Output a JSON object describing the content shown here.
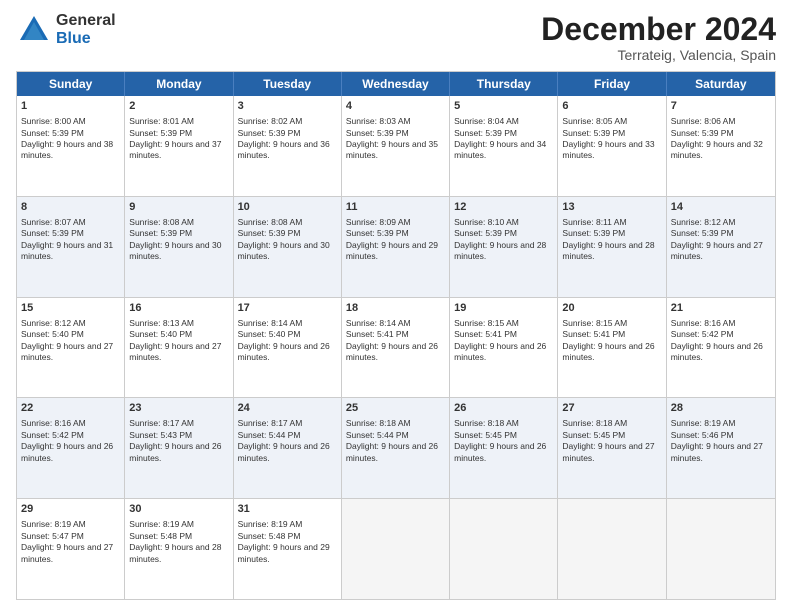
{
  "header": {
    "logo": {
      "general": "General",
      "blue": "Blue"
    },
    "title": "December 2024",
    "location": "Terrateig, Valencia, Spain"
  },
  "calendar": {
    "days": [
      "Sunday",
      "Monday",
      "Tuesday",
      "Wednesday",
      "Thursday",
      "Friday",
      "Saturday"
    ],
    "rows": [
      [
        {
          "day": "1",
          "sunrise": "Sunrise: 8:00 AM",
          "sunset": "Sunset: 5:39 PM",
          "daylight": "Daylight: 9 hours and 38 minutes."
        },
        {
          "day": "2",
          "sunrise": "Sunrise: 8:01 AM",
          "sunset": "Sunset: 5:39 PM",
          "daylight": "Daylight: 9 hours and 37 minutes."
        },
        {
          "day": "3",
          "sunrise": "Sunrise: 8:02 AM",
          "sunset": "Sunset: 5:39 PM",
          "daylight": "Daylight: 9 hours and 36 minutes."
        },
        {
          "day": "4",
          "sunrise": "Sunrise: 8:03 AM",
          "sunset": "Sunset: 5:39 PM",
          "daylight": "Daylight: 9 hours and 35 minutes."
        },
        {
          "day": "5",
          "sunrise": "Sunrise: 8:04 AM",
          "sunset": "Sunset: 5:39 PM",
          "daylight": "Daylight: 9 hours and 34 minutes."
        },
        {
          "day": "6",
          "sunrise": "Sunrise: 8:05 AM",
          "sunset": "Sunset: 5:39 PM",
          "daylight": "Daylight: 9 hours and 33 minutes."
        },
        {
          "day": "7",
          "sunrise": "Sunrise: 8:06 AM",
          "sunset": "Sunset: 5:39 PM",
          "daylight": "Daylight: 9 hours and 32 minutes."
        }
      ],
      [
        {
          "day": "8",
          "sunrise": "Sunrise: 8:07 AM",
          "sunset": "Sunset: 5:39 PM",
          "daylight": "Daylight: 9 hours and 31 minutes."
        },
        {
          "day": "9",
          "sunrise": "Sunrise: 8:08 AM",
          "sunset": "Sunset: 5:39 PM",
          "daylight": "Daylight: 9 hours and 30 minutes."
        },
        {
          "day": "10",
          "sunrise": "Sunrise: 8:08 AM",
          "sunset": "Sunset: 5:39 PM",
          "daylight": "Daylight: 9 hours and 30 minutes."
        },
        {
          "day": "11",
          "sunrise": "Sunrise: 8:09 AM",
          "sunset": "Sunset: 5:39 PM",
          "daylight": "Daylight: 9 hours and 29 minutes."
        },
        {
          "day": "12",
          "sunrise": "Sunrise: 8:10 AM",
          "sunset": "Sunset: 5:39 PM",
          "daylight": "Daylight: 9 hours and 28 minutes."
        },
        {
          "day": "13",
          "sunrise": "Sunrise: 8:11 AM",
          "sunset": "Sunset: 5:39 PM",
          "daylight": "Daylight: 9 hours and 28 minutes."
        },
        {
          "day": "14",
          "sunrise": "Sunrise: 8:12 AM",
          "sunset": "Sunset: 5:39 PM",
          "daylight": "Daylight: 9 hours and 27 minutes."
        }
      ],
      [
        {
          "day": "15",
          "sunrise": "Sunrise: 8:12 AM",
          "sunset": "Sunset: 5:40 PM",
          "daylight": "Daylight: 9 hours and 27 minutes."
        },
        {
          "day": "16",
          "sunrise": "Sunrise: 8:13 AM",
          "sunset": "Sunset: 5:40 PM",
          "daylight": "Daylight: 9 hours and 27 minutes."
        },
        {
          "day": "17",
          "sunrise": "Sunrise: 8:14 AM",
          "sunset": "Sunset: 5:40 PM",
          "daylight": "Daylight: 9 hours and 26 minutes."
        },
        {
          "day": "18",
          "sunrise": "Sunrise: 8:14 AM",
          "sunset": "Sunset: 5:41 PM",
          "daylight": "Daylight: 9 hours and 26 minutes."
        },
        {
          "day": "19",
          "sunrise": "Sunrise: 8:15 AM",
          "sunset": "Sunset: 5:41 PM",
          "daylight": "Daylight: 9 hours and 26 minutes."
        },
        {
          "day": "20",
          "sunrise": "Sunrise: 8:15 AM",
          "sunset": "Sunset: 5:41 PM",
          "daylight": "Daylight: 9 hours and 26 minutes."
        },
        {
          "day": "21",
          "sunrise": "Sunrise: 8:16 AM",
          "sunset": "Sunset: 5:42 PM",
          "daylight": "Daylight: 9 hours and 26 minutes."
        }
      ],
      [
        {
          "day": "22",
          "sunrise": "Sunrise: 8:16 AM",
          "sunset": "Sunset: 5:42 PM",
          "daylight": "Daylight: 9 hours and 26 minutes."
        },
        {
          "day": "23",
          "sunrise": "Sunrise: 8:17 AM",
          "sunset": "Sunset: 5:43 PM",
          "daylight": "Daylight: 9 hours and 26 minutes."
        },
        {
          "day": "24",
          "sunrise": "Sunrise: 8:17 AM",
          "sunset": "Sunset: 5:44 PM",
          "daylight": "Daylight: 9 hours and 26 minutes."
        },
        {
          "day": "25",
          "sunrise": "Sunrise: 8:18 AM",
          "sunset": "Sunset: 5:44 PM",
          "daylight": "Daylight: 9 hours and 26 minutes."
        },
        {
          "day": "26",
          "sunrise": "Sunrise: 8:18 AM",
          "sunset": "Sunset: 5:45 PM",
          "daylight": "Daylight: 9 hours and 26 minutes."
        },
        {
          "day": "27",
          "sunrise": "Sunrise: 8:18 AM",
          "sunset": "Sunset: 5:45 PM",
          "daylight": "Daylight: 9 hours and 27 minutes."
        },
        {
          "day": "28",
          "sunrise": "Sunrise: 8:19 AM",
          "sunset": "Sunset: 5:46 PM",
          "daylight": "Daylight: 9 hours and 27 minutes."
        }
      ],
      [
        {
          "day": "29",
          "sunrise": "Sunrise: 8:19 AM",
          "sunset": "Sunset: 5:47 PM",
          "daylight": "Daylight: 9 hours and 27 minutes."
        },
        {
          "day": "30",
          "sunrise": "Sunrise: 8:19 AM",
          "sunset": "Sunset: 5:48 PM",
          "daylight": "Daylight: 9 hours and 28 minutes."
        },
        {
          "day": "31",
          "sunrise": "Sunrise: 8:19 AM",
          "sunset": "Sunset: 5:48 PM",
          "daylight": "Daylight: 9 hours and 29 minutes."
        },
        null,
        null,
        null,
        null
      ]
    ]
  }
}
